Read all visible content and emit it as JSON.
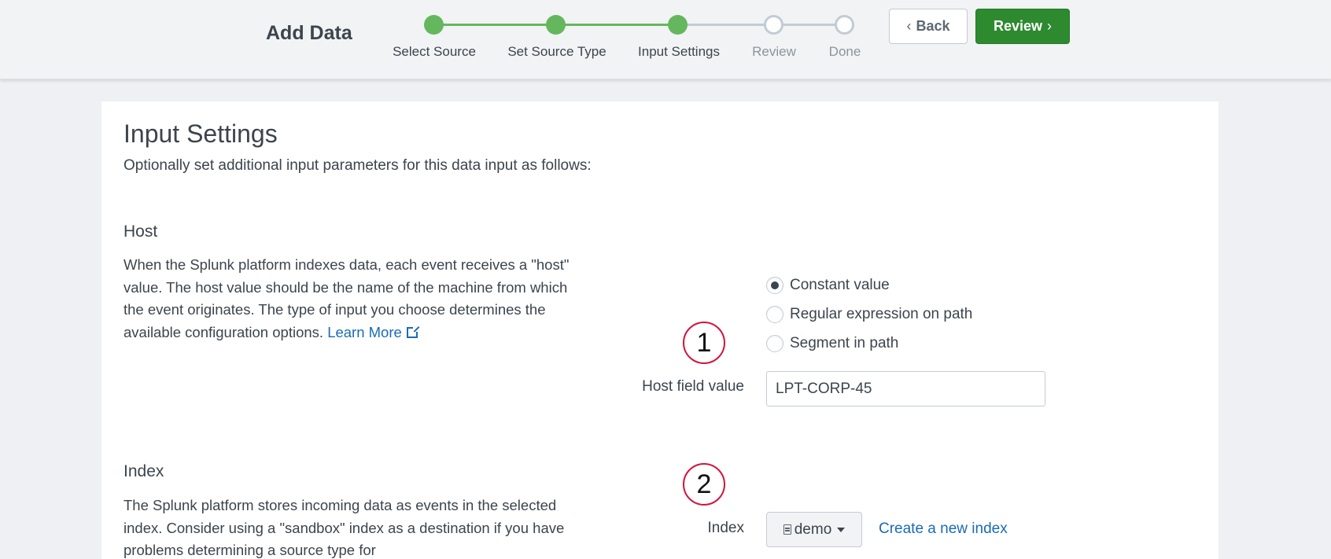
{
  "header": {
    "title": "Add Data",
    "back_label": "Back",
    "review_label": "Review"
  },
  "steps": [
    {
      "label": "Select Source",
      "state": "done"
    },
    {
      "label": "Set Source Type",
      "state": "done"
    },
    {
      "label": "Input Settings",
      "state": "done"
    },
    {
      "label": "Review",
      "state": "todo"
    },
    {
      "label": "Done",
      "state": "todo"
    }
  ],
  "page": {
    "title": "Input Settings",
    "subtitle": "Optionally set additional input parameters for this data input as follows:"
  },
  "host": {
    "heading": "Host",
    "description": "When the Splunk platform indexes data, each event receives a \"host\" value. The host value should be the name of the machine from which the event originates. The type of input you choose determines the available configuration options.",
    "learn_more": "Learn More",
    "options": [
      {
        "label": "Constant value",
        "checked": true
      },
      {
        "label": "Regular expression on path",
        "checked": false
      },
      {
        "label": "Segment in path",
        "checked": false
      }
    ],
    "field_label": "Host field value",
    "field_value": "LPT-CORP-45"
  },
  "index": {
    "heading": "Index",
    "description": "The Splunk platform stores incoming data as events in the selected index. Consider using a \"sandbox\" index as a destination if you have problems determining a source type for",
    "field_label": "Index",
    "selected": "demo",
    "create_link": "Create a new index"
  },
  "annotations": [
    "1",
    "2"
  ],
  "colors": {
    "accent_green": "#65b75e",
    "primary_button": "#2d8a2f",
    "link": "#1a6bb5",
    "annotation_red": "#d3133c"
  }
}
